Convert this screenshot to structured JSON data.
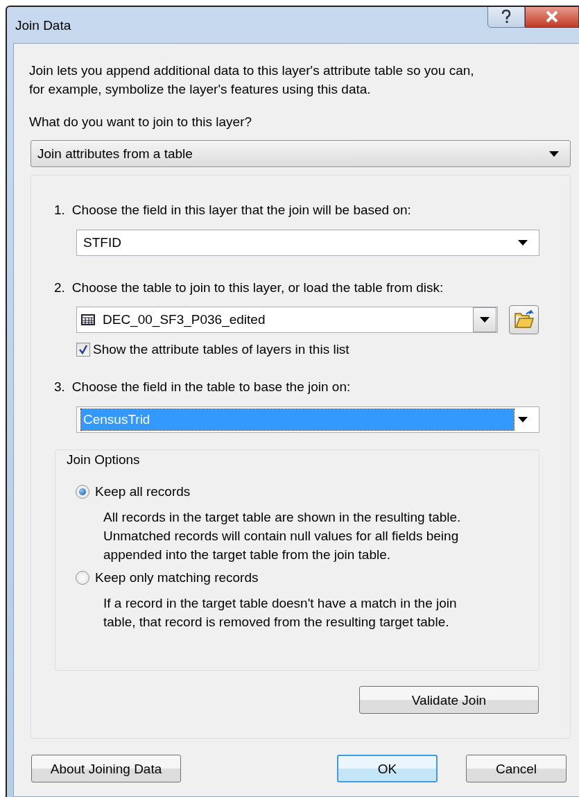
{
  "window": {
    "title": "Join Data"
  },
  "intro_lines": [
    "Join lets you append additional data to this layer's attribute table so you can,",
    "for example, symbolize the layer's features using this data."
  ],
  "question": "What do you want to join to this layer?",
  "join_type": {
    "value": "Join attributes from a table",
    "focused": false
  },
  "steps": [
    {
      "number": "1.",
      "label": "Choose the field in this layer that the join will be based on:",
      "combo": {
        "value": "STFID",
        "focused": false,
        "table_icon": false,
        "browse_button": false
      }
    },
    {
      "number": "2.",
      "label": "Choose the table to join to this layer, or load the table from disk:",
      "combo": {
        "value": "DEC_00_SF3_P036_edited",
        "focused": false,
        "table_icon": true,
        "browse_button": true
      },
      "checkbox": {
        "label": "Show the attribute tables of layers in this list",
        "checked": true
      }
    },
    {
      "number": "3.",
      "label": "Choose the field in the table to base the join on:",
      "combo": {
        "value": "CensusTrid",
        "focused": true,
        "table_icon": false,
        "browse_button": false
      }
    }
  ],
  "join_options": {
    "title": "Join Options",
    "options": [
      {
        "label": "Keep all records",
        "selected": true,
        "description_lines": [
          "All records in the target table are shown in the resulting table.",
          "Unmatched records will contain null values for all fields being",
          "appended into the target table from the join table."
        ]
      },
      {
        "label": "Keep only matching records",
        "selected": false,
        "description_lines": [
          "If a record in the target table doesn't have a match in the join",
          "table, that record is removed from the resulting target table."
        ]
      }
    ]
  },
  "validate_button": "Validate Join",
  "footer": {
    "help_button": "About Joining Data",
    "buttons": [
      {
        "label": "OK",
        "default": true
      },
      {
        "label": "Cancel",
        "default": false
      }
    ]
  }
}
